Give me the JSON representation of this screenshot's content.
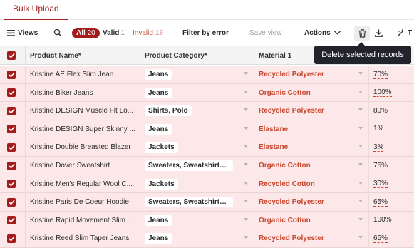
{
  "tabs": {
    "active": "Bulk Upload"
  },
  "toolbar": {
    "views_label": "Views",
    "all_label": "All",
    "all_count": "20",
    "valid_label": "Valid",
    "valid_count": "1",
    "invalid_label": "Invalid",
    "invalid_count": "19",
    "filter_label": "Filter by error",
    "save_view_label": "Save view",
    "actions_label": "Actions",
    "truncated_label": "T"
  },
  "tooltip": {
    "text": "Delete selected records"
  },
  "columns": [
    "Product Name*",
    "Product Category*",
    "Material 1"
  ],
  "rows": [
    {
      "name": "Kristine AE Flex Slim Jean",
      "category": "Jeans",
      "material": "Recycled Polyester",
      "pct": "70%"
    },
    {
      "name": "Kristine Biker Jeans",
      "category": "Jeans",
      "material": "Organic Cotton",
      "pct": "100%"
    },
    {
      "name": "Kristine DESIGN Muscle Fit Lo...",
      "category": "Shirts, Polo",
      "material": "Recycled Polyester",
      "pct": "80%"
    },
    {
      "name": "Kristine DESIGN Super Skinny ...",
      "category": "Jeans",
      "material": "Elastane",
      "pct": "1%"
    },
    {
      "name": "Kristine Double Breasted Blazer",
      "category": "Jackets",
      "material": "Elastane",
      "pct": "3%"
    },
    {
      "name": "Kristine Dover Sweatshirt",
      "category": "Sweaters, Sweatshirts, ...",
      "material": "Organic Cotton",
      "pct": "75%"
    },
    {
      "name": "Kristine Men's Regular Wool C...",
      "category": "Jackets",
      "material": "Recycled Cotton",
      "pct": "30%"
    },
    {
      "name": "Kristine Paris De Coeur Hoodie",
      "category": "Sweaters, Sweatshirts, ...",
      "material": "Recycled Polyester",
      "pct": "65%"
    },
    {
      "name": "Kristine Rapid Movement Slim ...",
      "category": "Jeans",
      "material": "Organic Cotton",
      "pct": "100%"
    },
    {
      "name": "Kristine Reed Slim Taper Jeans",
      "category": "Jeans",
      "material": "Recycled Polyester",
      "pct": "65%"
    }
  ]
}
